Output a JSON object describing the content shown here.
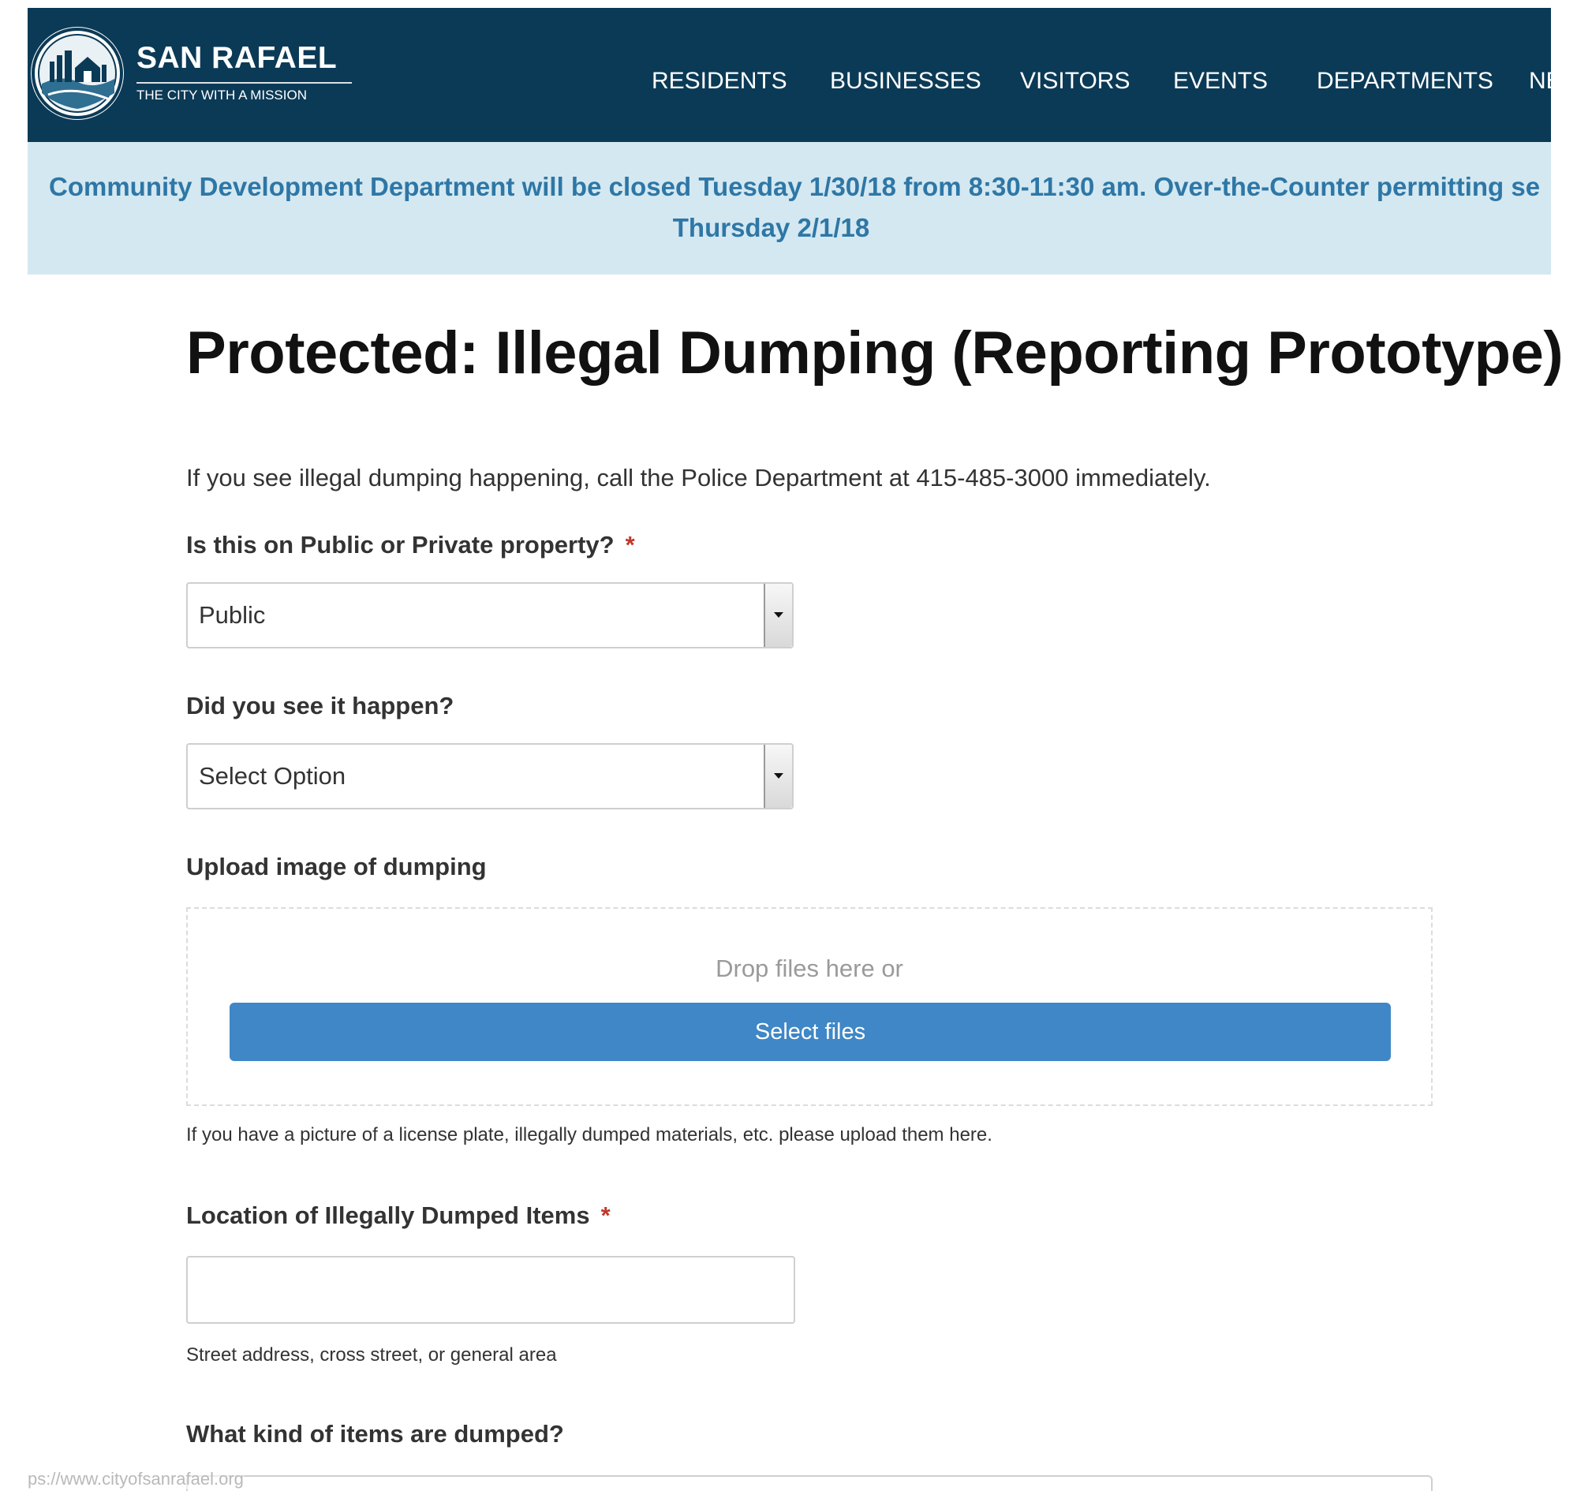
{
  "header": {
    "brand_title": "SAN RAFAEL",
    "brand_tagline": "THE CITY WITH A MISSION",
    "nav": [
      "RESIDENTS",
      "BUSINESSES",
      "VISITORS",
      "EVENTS",
      "DEPARTMENTS",
      "NE"
    ],
    "background_color": "#0b3a56"
  },
  "alert": {
    "line1": "Community Development Department will be closed Tuesday 1/30/18 from 8:30-11:30 am. Over-the-Counter permitting se",
    "line2": "Thursday 2/1/18",
    "background_color": "#d4e8f1",
    "text_color": "#2e77a6"
  },
  "page": {
    "title": "Protected: Illegal Dumping (Reporting Prototype)",
    "intro": "If you see illegal dumping happening, call the Police Department at 415-485-3000 immediately."
  },
  "form": {
    "property": {
      "label": "Is this on Public or Private property?",
      "required_marker": "*",
      "value": "Public"
    },
    "witnessed": {
      "label": "Did you see it happen?",
      "value": "Select Option"
    },
    "upload": {
      "label": "Upload image of dumping",
      "drop_text": "Drop files here or",
      "button_label": "Select files",
      "help": "If you have a picture of a license plate, illegally dumped materials, etc. please upload them here.",
      "button_color": "#3f87c6"
    },
    "location": {
      "label": "Location of Illegally Dumped Items",
      "required_marker": "*",
      "value": "",
      "help": "Street address, cross street, or general area"
    },
    "items": {
      "label": "What kind of items are dumped?"
    }
  },
  "status_bar": {
    "url": "ps://www.cityofsanrafael.org"
  }
}
